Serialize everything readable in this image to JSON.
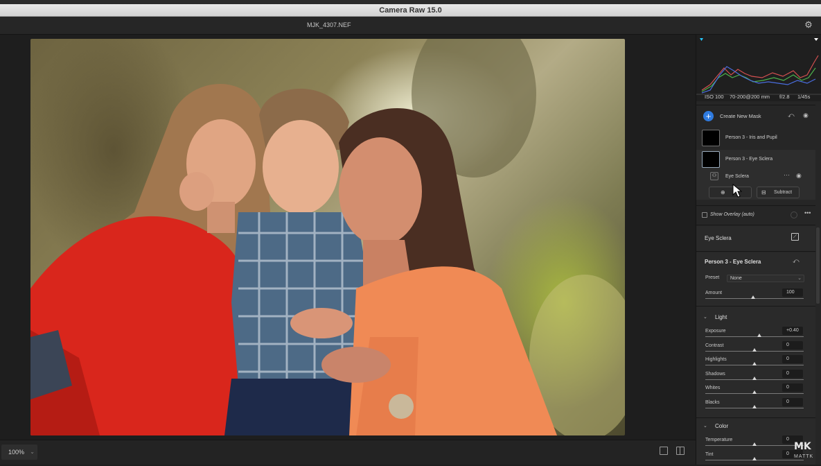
{
  "window": {
    "title": "Camera Raw 15.0",
    "filename": "MJK_4307.NEF"
  },
  "exif": {
    "iso": "ISO 100",
    "lens": "70-200@200 mm",
    "aperture": "f/2.8",
    "shutter": "1/45s"
  },
  "masks": {
    "create_label": "Create New Mask",
    "items": [
      {
        "name": "Person 3 - Iris and Pupil"
      },
      {
        "name": "Person 3 - Eye Sclera"
      }
    ],
    "component": "Eye Sclera",
    "add_label": "",
    "subtract_label": "Subtract",
    "overlay_label": "Show Overlay (auto)"
  },
  "panel": {
    "component_title": "Eye Sclera",
    "mask_title": "Person 3 - Eye Sclera",
    "preset_label": "Preset",
    "preset_value": "None",
    "amount_label": "Amount",
    "amount_value": "100",
    "light_title": "Light",
    "color_title": "Color"
  },
  "light_sliders": [
    {
      "label": "Exposure",
      "value": "+0.40",
      "position": 0.55
    },
    {
      "label": "Contrast",
      "value": "0",
      "position": 0.5
    },
    {
      "label": "Highlights",
      "value": "0",
      "position": 0.5
    },
    {
      "label": "Shadows",
      "value": "0",
      "position": 0.5
    },
    {
      "label": "Whites",
      "value": "0",
      "position": 0.5
    },
    {
      "label": "Blacks",
      "value": "0",
      "position": 0.5
    }
  ],
  "color_sliders": [
    {
      "label": "Temperature",
      "value": "0",
      "position": 0.5
    },
    {
      "label": "Tint",
      "value": "0",
      "position": 0.5
    }
  ],
  "statusbar": {
    "zoom": "100%"
  },
  "watermark": {
    "logo": "MK",
    "text": "MATTK"
  },
  "icons": {
    "gear": "gear-icon",
    "visibility": "eye-icon",
    "reset": "reset-icon",
    "more": "more-icon"
  }
}
